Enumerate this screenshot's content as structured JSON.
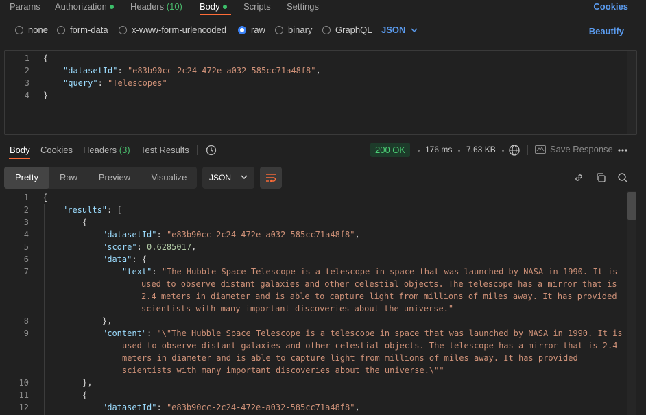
{
  "request_tabs": [
    {
      "label": "Params"
    },
    {
      "label": "Authorization",
      "dot": true
    },
    {
      "label": "Headers",
      "count": "(10)"
    },
    {
      "label": "Body",
      "dot": true,
      "active": true
    },
    {
      "label": "Scripts"
    },
    {
      "label": "Settings"
    }
  ],
  "cookies_label": "Cookies",
  "body_types": [
    {
      "label": "none",
      "selected": false
    },
    {
      "label": "form-data",
      "selected": false
    },
    {
      "label": "x-www-form-urlencoded",
      "selected": false
    },
    {
      "label": "raw",
      "selected": true
    },
    {
      "label": "binary",
      "selected": false
    },
    {
      "label": "GraphQL",
      "selected": false
    }
  ],
  "raw_language": "JSON",
  "beautify_label": "Beautify",
  "request_body": {
    "line_numbers": [
      "1",
      "2",
      "3",
      "4"
    ],
    "datasetId_key": "\"datasetId\"",
    "datasetId_value": "\"e83b90cc-2c24-472e-a032-585cc71a48f8\"",
    "query_key": "\"query\"",
    "query_value": "\"Telescopes\""
  },
  "response_tabs": [
    {
      "label": "Body",
      "active": true
    },
    {
      "label": "Cookies"
    },
    {
      "label": "Headers",
      "count": "(3)"
    },
    {
      "label": "Test Results"
    }
  ],
  "response_meta": {
    "status": "200 OK",
    "time": "176 ms",
    "size": "7.63 KB",
    "save_label": "Save Response"
  },
  "view_modes": [
    "Pretty",
    "Raw",
    "Preview",
    "Visualize"
  ],
  "active_view_mode": "Pretty",
  "response_format": "JSON",
  "response_body": {
    "line_numbers": [
      "1",
      "2",
      "3",
      "4",
      "5",
      "6",
      "7",
      "8",
      "9",
      "10",
      "11",
      "12"
    ],
    "results_key": "\"results\"",
    "datasetId_key": "\"datasetId\"",
    "datasetId_value": "\"e83b90cc-2c24-472e-a032-585cc71a48f8\"",
    "score_key": "\"score\"",
    "score_value": "0.6285017",
    "data_key": "\"data\"",
    "text_key": "\"text\"",
    "text_value_lines": [
      "\"The Hubble Space Telescope is a telescope in space that was launched by NASA in 1990. It is",
      "used to observe distant galaxies and other celestial objects. The telescope has a mirror that is",
      "2.4 meters in diameter and is able to capture light from millions of miles away. It has provided",
      "scientists with many important discoveries about the universe.\""
    ],
    "content_key": "\"content\"",
    "content_value_lines": [
      "\"\\\"The Hubble Space Telescope is a telescope in space that was launched by NASA in 1990. It is",
      "used to observe distant galaxies and other celestial objects. The telescope has a mirror that is 2.4",
      "meters in diameter and is able to capture light from millions of miles away. It has provided",
      "scientists with many important discoveries about the universe.\\\"\""
    ],
    "datasetId_value_2": "\"e83b90cc-2c24-472e-a032-585cc71a48f8\""
  },
  "icons": {
    "history": "history-icon",
    "globe": "globe-icon",
    "save": "save-response-icon",
    "more": "more-icon",
    "wrap": "wrap-lines-icon",
    "link": "link-icon",
    "copy": "copy-icon",
    "search": "search-icon"
  },
  "colors": {
    "accent": "#ff6c37",
    "link": "#5b9cf0",
    "success": "#4ccf75",
    "json_key": "#9cdcfe",
    "json_string": "#ce9178"
  }
}
